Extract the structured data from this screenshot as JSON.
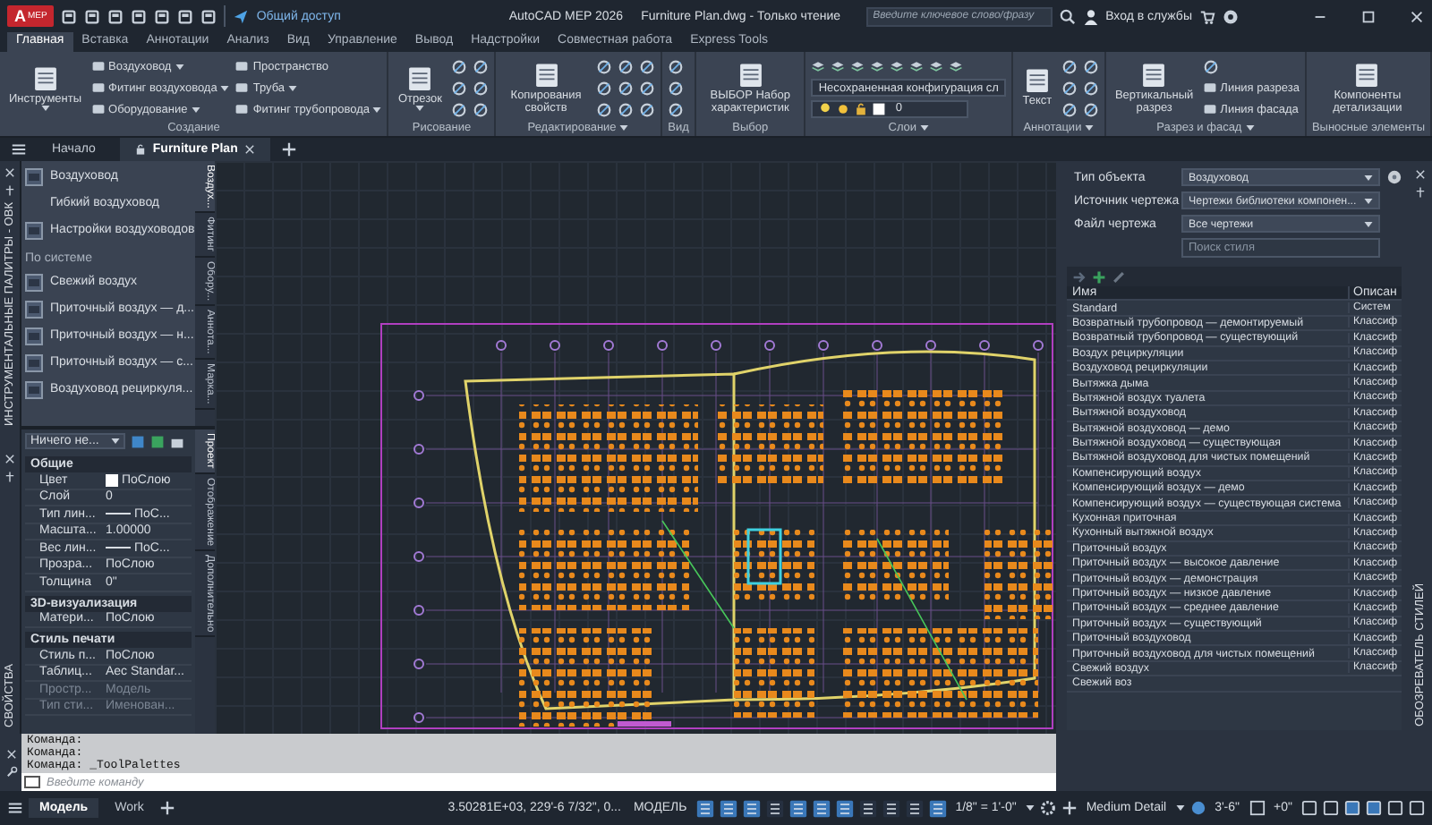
{
  "title_bar": {
    "logo": {
      "letter": "A",
      "product": "MEP"
    },
    "share": "Общий доступ",
    "title": "AutoCAD MEP 2026",
    "document": "Furniture Plan.dwg - Только чтение",
    "search": {
      "placeholder": "Введите ключевое слово/фразу"
    },
    "sign_in": "Вход в службы"
  },
  "ribbon": {
    "tabs": [
      {
        "label": "Главная",
        "selected": true
      },
      {
        "label": "Вставка",
        "selected": false
      },
      {
        "label": "Аннотации",
        "selected": false
      },
      {
        "label": "Анализ",
        "selected": false
      },
      {
        "label": "Вид",
        "selected": false
      },
      {
        "label": "Управление",
        "selected": false
      },
      {
        "label": "Вывод",
        "selected": false
      },
      {
        "label": "Надстройки",
        "selected": false
      },
      {
        "label": "Совместная работа",
        "selected": false
      },
      {
        "label": "Express Tools",
        "selected": false
      }
    ],
    "groups": [
      {
        "title": "Создание",
        "items": [
          {
            "kind": "large",
            "label": "Инструменты",
            "caret": true
          },
          {
            "kind": "small",
            "label": "Воздуховод",
            "caret": true
          },
          {
            "kind": "small",
            "label": "Фитинг воздуховода",
            "caret": true
          },
          {
            "kind": "small",
            "label": "Оборудование",
            "caret": true
          },
          {
            "kind": "small",
            "label": "Пространство",
            "caret": false
          },
          {
            "kind": "small",
            "label": "Труба",
            "caret": true
          },
          {
            "kind": "small",
            "label": "Фитинг трубопровода",
            "caret": true
          }
        ]
      },
      {
        "title": "Рисование",
        "items": [
          {
            "kind": "large",
            "label": "Отрезок",
            "caret": true
          },
          {
            "kind": "icon"
          },
          {
            "kind": "icon"
          },
          {
            "kind": "icon"
          },
          {
            "kind": "icon"
          },
          {
            "kind": "icon"
          },
          {
            "kind": "icon"
          }
        ]
      },
      {
        "title": "Редактирование",
        "caret": true,
        "items": [
          {
            "kind": "large",
            "label": "Копирования свойств",
            "caret": false
          },
          {
            "kind": "icon"
          },
          {
            "kind": "icon"
          },
          {
            "kind": "icon"
          },
          {
            "kind": "icon"
          },
          {
            "kind": "icon"
          },
          {
            "kind": "icon"
          },
          {
            "kind": "icon"
          },
          {
            "kind": "icon"
          },
          {
            "kind": "icon"
          }
        ]
      },
      {
        "title": "Вид",
        "items": [
          {
            "kind": "icon"
          },
          {
            "kind": "icon"
          },
          {
            "kind": "icon"
          }
        ]
      },
      {
        "title": "Выбор",
        "items": [
          {
            "kind": "large",
            "label": "ВЫБОР Набор характеристик",
            "caret": false
          }
        ]
      },
      {
        "title": "Слои",
        "caret": true,
        "items": [
          {
            "kind": "toolbar"
          },
          {
            "kind": "select",
            "label": "Несохраненная конфигурация сл"
          },
          {
            "kind": "layer",
            "label": "0"
          }
        ]
      },
      {
        "title": "Аннотации",
        "caret": true,
        "items": [
          {
            "kind": "large",
            "label": "Текст",
            "caret": false
          },
          {
            "kind": "icon"
          },
          {
            "kind": "icon"
          },
          {
            "kind": "icon"
          },
          {
            "kind": "icon"
          },
          {
            "kind": "icon"
          },
          {
            "kind": "icon"
          }
        ]
      },
      {
        "title": "Разрез и фасад",
        "caret": true,
        "items": [
          {
            "kind": "large",
            "label": "Вертикальный разрез",
            "caret": false
          },
          {
            "kind": "icon"
          },
          {
            "kind": "small",
            "label": "Линия разреза",
            "caret": false
          },
          {
            "kind": "small",
            "label": "Линия фасада",
            "caret": false
          }
        ]
      },
      {
        "title": "Выносные элементы",
        "items": [
          {
            "kind": "large",
            "label": "Компоненты детализации",
            "caret": false
          }
        ]
      }
    ]
  },
  "document_tabs": [
    {
      "label": "Начало",
      "selected": false,
      "closable": false
    },
    {
      "label": "Furniture Plan",
      "selected": true,
      "closable": true
    }
  ],
  "tool_palette": {
    "title": "ИНСТРУМЕНТАЛЬНЫЕ ПАЛИТРЫ - ОВК",
    "items": [
      {
        "kind": "tool",
        "label": "Воздуховод"
      },
      {
        "kind": "plain",
        "label": "Гибкий воздуховод"
      },
      {
        "kind": "tool",
        "label": "Настройки воздуховодов"
      },
      {
        "kind": "section",
        "label": "По системе"
      },
      {
        "kind": "tool",
        "label": "Свежий воздух"
      },
      {
        "kind": "tool",
        "label": "Приточный воздух — д..."
      },
      {
        "kind": "tool",
        "label": "Приточный воздух — н..."
      },
      {
        "kind": "tool",
        "label": "Приточный воздух — с..."
      },
      {
        "kind": "tool",
        "label": "Воздуховод рециркуля..."
      }
    ],
    "tabs": [
      {
        "label": "Воздух...",
        "selected": true
      },
      {
        "label": "Фитинг",
        "selected": false
      },
      {
        "label": "Обору...",
        "selected": false
      },
      {
        "label": "Аннота...",
        "selected": false
      },
      {
        "label": "Марка...",
        "selected": false
      }
    ]
  },
  "properties": {
    "title": "СВОЙСТВА",
    "selection": "Ничего не...",
    "sections": [
      {
        "title": "Общие",
        "rows": [
          {
            "label": "Цвет",
            "value": "ПоСлою",
            "kind": "color",
            "disabled": false
          },
          {
            "label": "Слой",
            "value": "0",
            "kind": "text",
            "disabled": false
          },
          {
            "label": "Тип лин...",
            "value": "ПоС...",
            "kind": "line",
            "disabled": false
          },
          {
            "label": "Масшта...",
            "value": "1.00000",
            "kind": "text",
            "disabled": false
          },
          {
            "label": "Вес лин...",
            "value": "ПоС...",
            "kind": "line",
            "disabled": false
          },
          {
            "label": "Прозра...",
            "value": "ПоСлою",
            "kind": "text",
            "disabled": false
          },
          {
            "label": "Толщина",
            "value": "0\"",
            "kind": "text",
            "disabled": false
          }
        ]
      },
      {
        "title": "3D-визуализация",
        "rows": [
          {
            "label": "Матери...",
            "value": "ПоСлою",
            "kind": "text",
            "disabled": false
          }
        ]
      },
      {
        "title": "Стиль печати",
        "rows": [
          {
            "label": "Стиль п...",
            "value": "ПоСлою",
            "kind": "text",
            "disabled": false
          },
          {
            "label": "Таблиц...",
            "value": "Aec Standar...",
            "kind": "text",
            "disabled": false
          },
          {
            "label": "Простр...",
            "value": "Модель",
            "kind": "text",
            "disabled": true
          },
          {
            "label": "Тип сти...",
            "value": "Именован...",
            "kind": "text",
            "disabled": true
          }
        ]
      }
    ],
    "tabs": [
      {
        "label": "Проект",
        "selected": true
      },
      {
        "label": "Отображение",
        "selected": false
      },
      {
        "label": "Дополнительно",
        "selected": false
      }
    ]
  },
  "style_browser": {
    "title": "ОБОЗРЕВАТЕЛЬ СТИЛЕЙ",
    "fields": [
      {
        "label": "Тип объекта",
        "value": "Воздуховод"
      },
      {
        "label": "Источник чертежа",
        "value": "Чертежи библиотеки компонен..."
      },
      {
        "label": "Файл чертежа",
        "value": "Все чертежи"
      }
    ],
    "search": {
      "placeholder": "Поиск стиля"
    },
    "columns": [
      "Имя",
      "Описан"
    ],
    "rows": [
      {
        "name": "Standard",
        "description": "Систем"
      },
      {
        "name": "Возвратный трубопровод — демонтируемый",
        "description": "Классиф"
      },
      {
        "name": "Возвратный трубопровод — существующий",
        "description": "Классиф"
      },
      {
        "name": "Воздух рециркуляции",
        "description": "Классиф"
      },
      {
        "name": "Воздуховод рециркуляции",
        "description": "Классиф"
      },
      {
        "name": "Вытяжка дыма",
        "description": "Классиф"
      },
      {
        "name": "Вытяжной воздух туалета",
        "description": "Классиф"
      },
      {
        "name": "Вытяжной воздуховод",
        "description": "Классиф"
      },
      {
        "name": "Вытяжной воздуховод — демо",
        "description": "Классиф"
      },
      {
        "name": "Вытяжной воздуховод — существующая",
        "description": "Классиф"
      },
      {
        "name": "Вытяжной воздуховод для чистых помещений",
        "description": "Классиф"
      },
      {
        "name": "Компенсирующий воздух",
        "description": "Классиф"
      },
      {
        "name": "Компенсирующий воздух — демо",
        "description": "Классиф"
      },
      {
        "name": "Компенсирующий воздух — существующая система",
        "description": "Классиф"
      },
      {
        "name": "Кухонная приточная",
        "description": "Классиф"
      },
      {
        "name": "Кухонный вытяжной воздух",
        "description": "Классиф"
      },
      {
        "name": "Приточный воздух",
        "description": "Классиф"
      },
      {
        "name": "Приточный воздух — высокое давление",
        "description": "Классиф"
      },
      {
        "name": "Приточный воздух — демонстрация",
        "description": "Классиф"
      },
      {
        "name": "Приточный воздух — низкое давление",
        "description": "Классиф"
      },
      {
        "name": "Приточный воздух — среднее давление",
        "description": "Классиф"
      },
      {
        "name": "Приточный воздух — существующий",
        "description": "Классиф"
      },
      {
        "name": "Приточный воздуховод",
        "description": "Классиф"
      },
      {
        "name": "Приточный воздуховод для чистых помещений",
        "description": "Классиф"
      },
      {
        "name": "Свежий воздух",
        "description": "Классиф"
      },
      {
        "name": "Свежий воз",
        "description": ""
      }
    ]
  },
  "command_line": {
    "history": [
      "Команда:",
      "Команда:",
      "Команда:  _ToolPalettes"
    ],
    "placeholder": "Введите команду"
  },
  "status_bar": {
    "layout_tabs": [
      {
        "label": "Модель",
        "selected": true
      },
      {
        "label": "Work",
        "selected": false
      }
    ],
    "coordinates": "3.50281E+03, 229'-6 7/32\", 0...",
    "space": "МОДЕЛЬ",
    "toggles": [
      {
        "on": true
      },
      {
        "on": true
      },
      {
        "on": true
      },
      {
        "on": false
      },
      {
        "on": true
      },
      {
        "on": true
      },
      {
        "on": true
      },
      {
        "on": false
      },
      {
        "on": false
      },
      {
        "on": false
      },
      {
        "on": true
      }
    ],
    "scale": "1/8\" = 1'-0\"",
    "detail": "Medium Detail",
    "elevation": "3'-6\"",
    "offset": "+0\""
  }
}
